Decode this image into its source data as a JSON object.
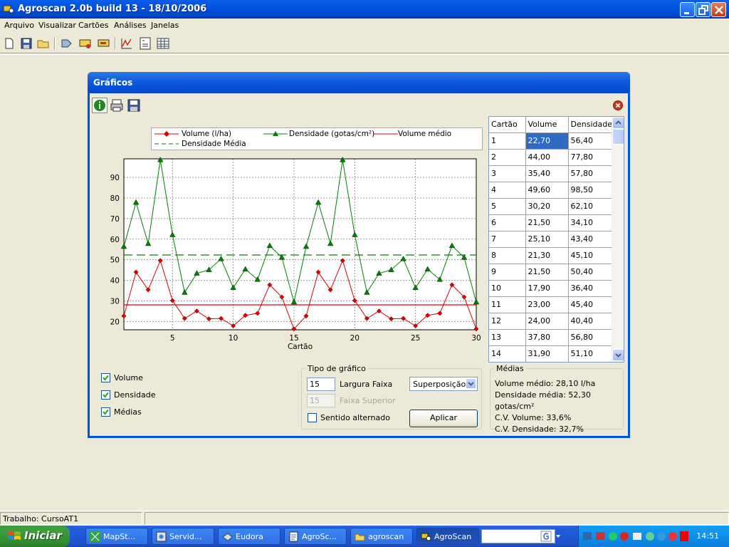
{
  "window": {
    "title": "Agroscan 2.0b build 13 - 18/10/2006"
  },
  "menu": [
    "Arquivo",
    "Visualizar",
    "Cartões",
    "Análises",
    "Janelas"
  ],
  "dialog": {
    "title": "Gráficos"
  },
  "legend": {
    "volume": "Volume (l/ha)",
    "densidade": "Densidade (gotas/cm²)",
    "volume_medio": "Volume médio",
    "densidade_media": "Densidade Média"
  },
  "chart_data": {
    "type": "line",
    "xlabel": "Cartão",
    "x": [
      1,
      2,
      3,
      4,
      5,
      6,
      7,
      8,
      9,
      10,
      11,
      12,
      13,
      14,
      15,
      16,
      17,
      18,
      19,
      20,
      21,
      22,
      23,
      24,
      25,
      26,
      27,
      28,
      29,
      30
    ],
    "xticks": [
      5,
      10,
      15,
      20,
      25,
      30
    ],
    "yticks": [
      20,
      30,
      40,
      50,
      60,
      70,
      80,
      90
    ],
    "ylim": [
      16,
      99
    ],
    "grid": true,
    "series": [
      {
        "name": "Volume (l/ha)",
        "color": "#e00000",
        "marker": "diamond",
        "values": [
          22.7,
          44.0,
          35.4,
          49.6,
          30.2,
          21.5,
          25.1,
          21.3,
          21.5,
          17.9,
          23.0,
          24.0,
          37.8,
          31.9,
          16.4,
          22.7,
          44.0,
          35.4,
          49.6,
          30.2,
          21.5,
          25.1,
          21.3,
          21.5,
          17.9,
          23.0,
          24.0,
          37.8,
          31.9,
          16.4
        ]
      },
      {
        "name": "Densidade (gotas/cm²)",
        "color": "#008000",
        "marker": "triangle",
        "values": [
          56.4,
          77.8,
          57.8,
          98.5,
          62.1,
          34.1,
          43.4,
          45.1,
          50.4,
          36.4,
          45.4,
          40.4,
          56.8,
          51.1,
          29.4,
          56.4,
          77.8,
          57.8,
          98.5,
          62.1,
          34.1,
          43.4,
          45.1,
          50.4,
          36.4,
          45.4,
          40.4,
          56.8,
          51.1,
          29.4
        ]
      },
      {
        "name": "Volume médio",
        "color": "#e00000",
        "style": "solid",
        "constant": 28.1
      },
      {
        "name": "Densidade Média",
        "color": "#008000",
        "style": "dashed",
        "constant": 52.3
      }
    ]
  },
  "table": {
    "headers": [
      "Cartão",
      "Volume",
      "Densidade"
    ],
    "rows": [
      [
        "1",
        "22,70",
        "56,40"
      ],
      [
        "2",
        "44,00",
        "77,80"
      ],
      [
        "3",
        "35,40",
        "57,80"
      ],
      [
        "4",
        "49,60",
        "98,50"
      ],
      [
        "5",
        "30,20",
        "62,10"
      ],
      [
        "6",
        "21,50",
        "34,10"
      ],
      [
        "7",
        "25,10",
        "43,40"
      ],
      [
        "8",
        "21,30",
        "45,10"
      ],
      [
        "9",
        "21,50",
        "50,40"
      ],
      [
        "10",
        "17,90",
        "36,40"
      ],
      [
        "11",
        "23,00",
        "45,40"
      ],
      [
        "12",
        "24,00",
        "40,40"
      ],
      [
        "13",
        "37,80",
        "56,80"
      ],
      [
        "14",
        "31,90",
        "51,10"
      ]
    ]
  },
  "checkboxes": [
    {
      "label": "Volume",
      "checked": true
    },
    {
      "label": "Densidade",
      "checked": true
    },
    {
      "label": "Médias",
      "checked": true
    }
  ],
  "tipo": {
    "title": "Tipo de gráfico",
    "largura_value": "15",
    "largura_label": "Largura Faixa",
    "superior_value": "15",
    "superior_label": "Faixa Superior",
    "sentido_label": "Sentido alternado",
    "mode": "Superposição",
    "apply": "Aplicar"
  },
  "medias": {
    "title": "Médias",
    "lines": [
      "Volume médio: 28,10 l/ha",
      "Densidade média: 52,30 gotas/cm²",
      "C.V. Volume: 33,6%",
      "C.V. Densidade: 32,7%"
    ]
  },
  "status": {
    "trabalho": "Trabalho: CursoAT1"
  },
  "taskbar": {
    "start": "Iniciar",
    "tasks": [
      "MapSt...",
      "Servid...",
      "Eudora",
      "AgroSc...",
      "agroscan",
      "AgroScan"
    ],
    "clock": "14:51"
  }
}
